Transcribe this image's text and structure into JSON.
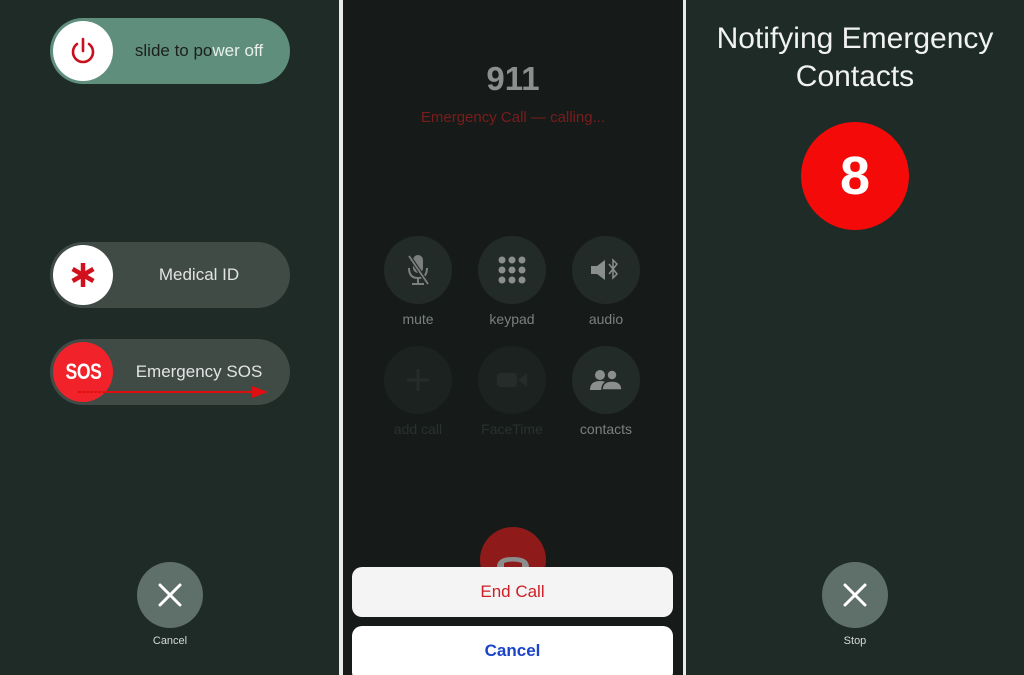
{
  "panel_left": {
    "power_slider": {
      "label_dark": "slide to po",
      "label_light": "wer off",
      "icon": "power-icon"
    },
    "medical_slider": {
      "label": "Medical ID",
      "icon": "asterisk-icon"
    },
    "sos_slider": {
      "label": "Emergency SOS",
      "knob_text": "SOS",
      "annotation": "swipe-right-arrow"
    },
    "cancel_button": {
      "label": "Cancel",
      "icon": "close-icon"
    }
  },
  "panel_middle": {
    "number": "911",
    "status": "Emergency Call — calling...",
    "controls": [
      {
        "label": "mute",
        "icon": "mic-slash-icon",
        "enabled": true
      },
      {
        "label": "keypad",
        "icon": "keypad-icon",
        "enabled": true
      },
      {
        "label": "audio",
        "icon": "speaker-bluetooth-icon",
        "enabled": true
      },
      {
        "label": "add call",
        "icon": "plus-icon",
        "enabled": false
      },
      {
        "label": "FaceTime",
        "icon": "video-camera-icon",
        "enabled": false
      },
      {
        "label": "contacts",
        "icon": "contacts-icon",
        "enabled": true
      }
    ],
    "end_call_icon": "phone-hangup-icon",
    "action_sheet": {
      "end_call_label": "End Call",
      "cancel_label": "Cancel"
    }
  },
  "panel_right": {
    "title": "Notifying Emergency Contacts",
    "countdown": "8",
    "stop_button": {
      "label": "Stop",
      "icon": "close-icon"
    }
  },
  "colors": {
    "emergency_red": "#f50a0a",
    "slider_green": "#5f8f7c",
    "cancel_blue": "#1a44c9",
    "end_call_red": "#cc1f26"
  }
}
